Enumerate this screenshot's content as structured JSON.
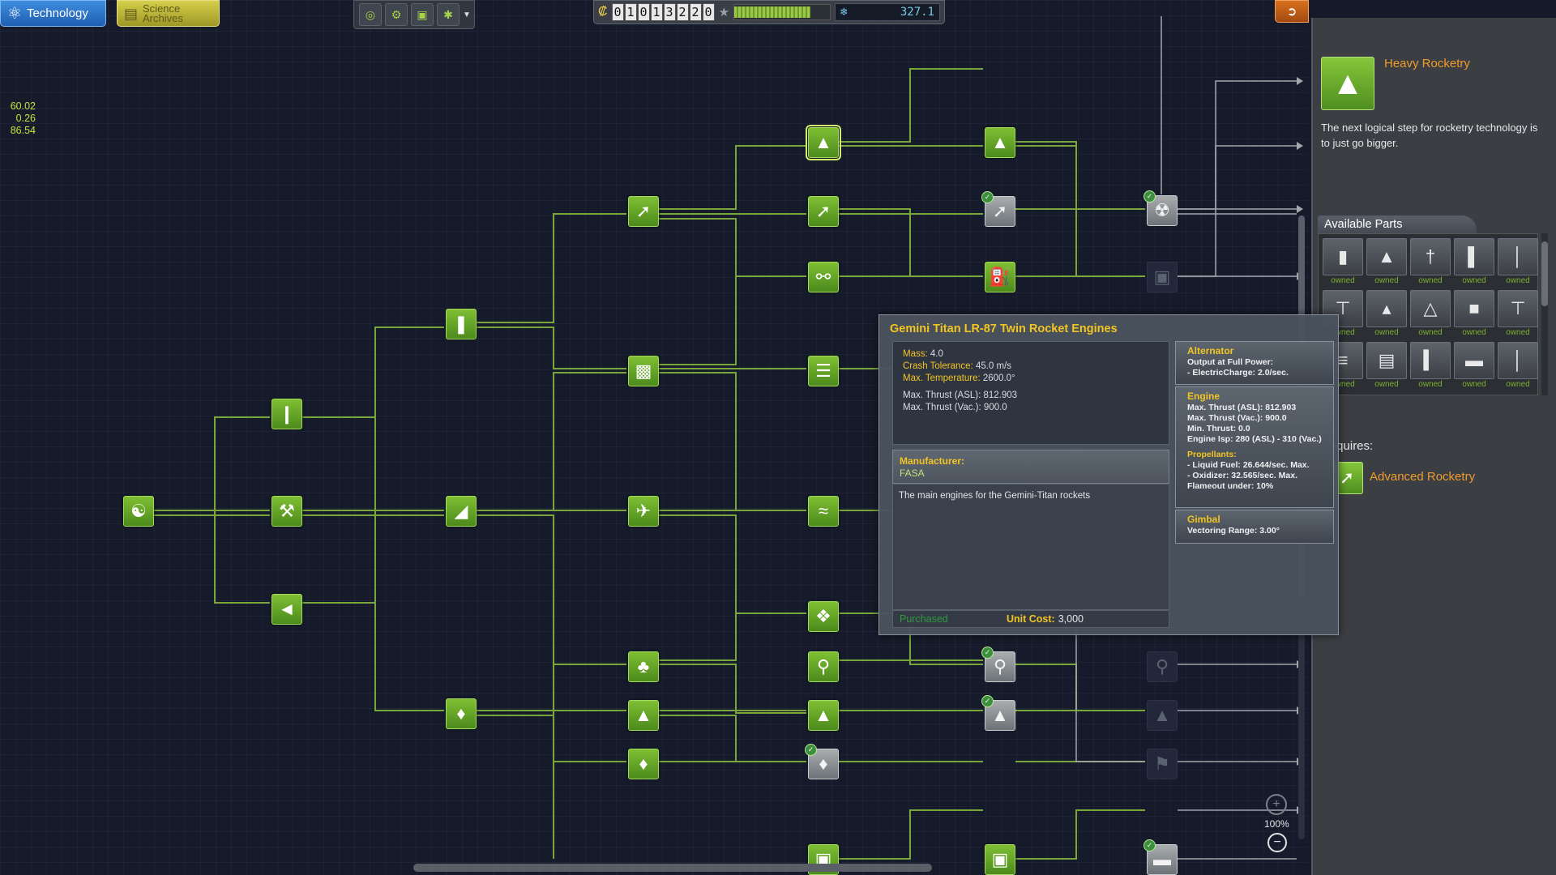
{
  "topbar": {
    "tabs": [
      {
        "label": "Technology",
        "icon": "atom-icon"
      },
      {
        "label": "Science Archives",
        "icon": "archive-icon"
      }
    ],
    "apps": [
      {
        "icon": "globe-icon",
        "glyph": "◎"
      },
      {
        "icon": "science-report-icon",
        "glyph": "⚙"
      },
      {
        "icon": "contracts-icon",
        "glyph": "▣"
      },
      {
        "icon": "settings-gear-icon",
        "glyph": "✱"
      }
    ],
    "funds_digits": [
      "0",
      "1",
      "0",
      "1",
      "3",
      "2",
      "2",
      "0"
    ],
    "reputation_level": 0.8,
    "science": "327.1",
    "exit_icon": "exit-icon"
  },
  "coords": {
    "line1": "60.02",
    "line2": "0.26",
    "line3": "86.54"
  },
  "tree": {
    "colors": {
      "researched_line": "#7aa53a",
      "locked_line": "#a3a6ab",
      "accent": "#f09b2b"
    }
  },
  "selected_node": {
    "title": "Heavy Rocketry",
    "description": "The next logical step for rocketry technology is to just go bigger.",
    "icon": "heavy-rocket-icon",
    "parts_header": "Available Parts",
    "parts": [
      {
        "icon": "capsule-part-icon",
        "glyph": "▮",
        "status": "owned"
      },
      {
        "icon": "adapter-part-icon",
        "glyph": "▲",
        "status": "owned"
      },
      {
        "icon": "engine-part-icon",
        "glyph": "†",
        "status": "owned"
      },
      {
        "icon": "tank-part-icon",
        "glyph": "▌",
        "status": "owned"
      },
      {
        "icon": "strut-part-icon",
        "glyph": "│",
        "status": "owned"
      },
      {
        "icon": "twin-engine-part-icon",
        "glyph": "⊤",
        "status": "owned"
      },
      {
        "icon": "nosecone-part-icon",
        "glyph": "▴",
        "status": "owned"
      },
      {
        "icon": "fairing-part-icon",
        "glyph": "△",
        "status": "owned"
      },
      {
        "icon": "container-part-icon",
        "glyph": "■",
        "status": "owned"
      },
      {
        "icon": "decoupler-part-icon",
        "glyph": "⊤",
        "status": "owned"
      },
      {
        "icon": "battery-part-icon",
        "glyph": "≡",
        "status": "owned"
      },
      {
        "icon": "drum-part-icon",
        "glyph": "▤",
        "status": "owned"
      },
      {
        "icon": "rod-part-icon",
        "glyph": "▍",
        "status": "owned"
      },
      {
        "icon": "disc-part-icon",
        "glyph": "▬",
        "status": "owned"
      },
      {
        "icon": "antenna-part-icon",
        "glyph": "│",
        "status": "owned"
      }
    ],
    "requires_label": "Requires:",
    "requires_name": "Advanced Rocketry",
    "requires_icon": "rocket-icon"
  },
  "tooltip": {
    "title": "Gemini Titan LR-87 Twin Rocket Engines",
    "stats": [
      {
        "key": "Mass:",
        "value": "4.0"
      },
      {
        "key": "Crash Tolerance:",
        "value": "45.0 m/s"
      },
      {
        "key": "Max. Temperature:",
        "value": "2600.0°"
      },
      {
        "key": "",
        "value": ""
      },
      {
        "key": "Max. Thrust (ASL):",
        "value": "812.903"
      },
      {
        "key": "Max. Thrust (Vac.):",
        "value": "900.0"
      }
    ],
    "manufacturer_label": "Manufacturer:",
    "manufacturer": "FASA",
    "description": "The main engines for the Gemini-Titan rockets",
    "status": "Purchased",
    "unit_cost_label": "Unit Cost:",
    "unit_cost": "3,000",
    "modules": {
      "alternator": {
        "title": "Alternator",
        "line1": "Output at Full Power:",
        "line2": "- ElectricCharge: 2.0/sec."
      },
      "engine": {
        "title": "Engine",
        "lines": [
          "Max. Thrust (ASL): 812.903",
          "Max. Thrust (Vac.): 900.0",
          "Min. Thrust: 0.0",
          "Engine Isp: 280 (ASL) - 310 (Vac.)"
        ],
        "propellants_title": "Propellants:",
        "propellants": [
          "- Liquid Fuel: 26.644/sec. Max.",
          "- Oxidizer: 32.565/sec. Max.",
          "Flameout under: 10%"
        ]
      },
      "gimbal": {
        "title": "Gimbal",
        "line1": "Vectoring Range: 3.00°"
      }
    }
  },
  "zoom": {
    "level": "100%"
  }
}
